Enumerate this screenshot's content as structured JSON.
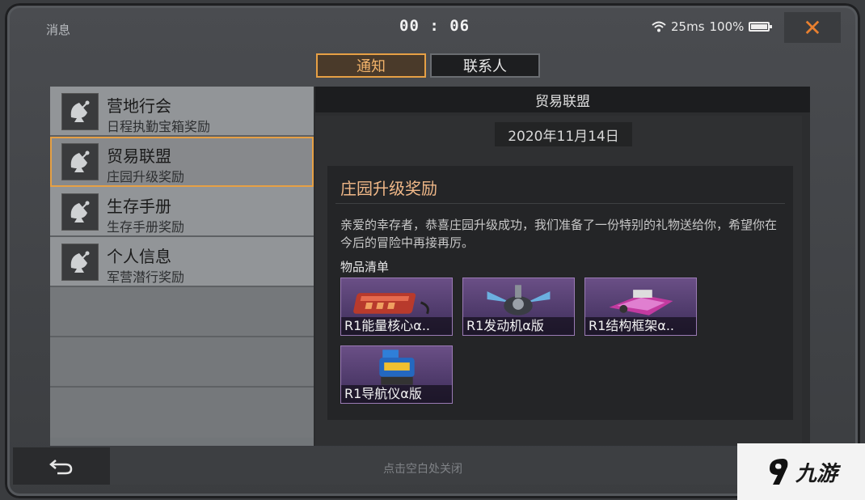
{
  "header": {
    "title": "消息",
    "timer": "00 : 06",
    "ping": "25ms",
    "battery": "100%",
    "battery_level": 1.0,
    "close_icon": "close-icon"
  },
  "tabs": [
    {
      "label": "通知",
      "active": true
    },
    {
      "label": "联系人",
      "active": false
    }
  ],
  "messages": [
    {
      "title": "营地行会",
      "subtitle": "日程执勤宝箱奖励",
      "icon": "satellite-dish-icon"
    },
    {
      "title": "贸易联盟",
      "subtitle": "庄园升级奖励",
      "icon": "satellite-dish-icon",
      "selected": true
    },
    {
      "title": "生存手册",
      "subtitle": "生存手册奖励",
      "icon": "satellite-dish-icon"
    },
    {
      "title": "个人信息",
      "subtitle": "军营潜行奖励",
      "icon": "satellite-dish-icon"
    }
  ],
  "detail": {
    "sender": "贸易联盟",
    "date": "2020年11月14日",
    "subject": "庄园升级奖励",
    "body": "亲爱的幸存者，恭喜庄园升级成功，我们准备了一份特别的礼物送给你，希望你在今后的冒险中再接再厉。",
    "items_label": "物品清单",
    "items": [
      {
        "label": "R1能量核心α..",
        "icon": "energy-core-icon"
      },
      {
        "label": "R1发动机α版",
        "icon": "engine-icon"
      },
      {
        "label": "R1结构框架α..",
        "icon": "frame-icon"
      },
      {
        "label": "R1导航仪α版",
        "icon": "navigator-icon"
      }
    ]
  },
  "footer": {
    "hint": "点击空白处关闭",
    "back_icon": "back-arrow-icon"
  },
  "watermark": {
    "text": "九游"
  },
  "colors": {
    "accent": "#e6a045",
    "close": "#e9802f",
    "subject": "#f0b888",
    "item_purple": "#6a4f86"
  }
}
